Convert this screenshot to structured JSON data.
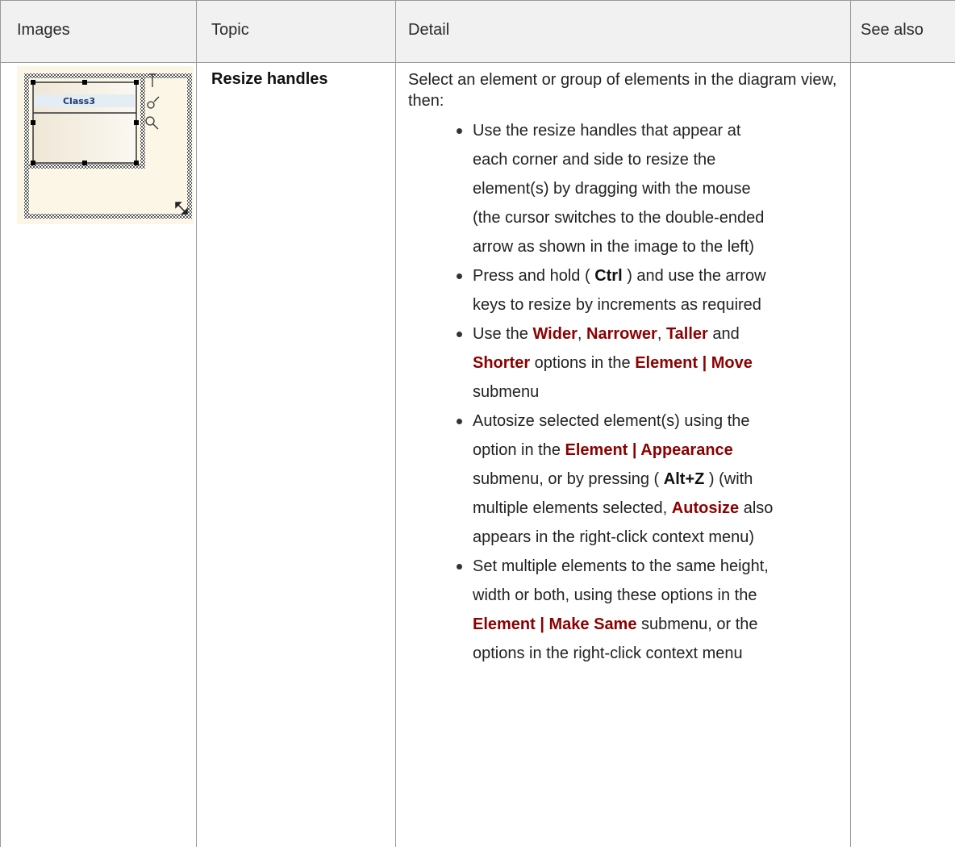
{
  "headers": {
    "images": "Images",
    "topic": "Topic",
    "detail": "Detail",
    "see_also": "See also"
  },
  "row": {
    "image": {
      "class_label": "Class3"
    },
    "topic": "Resize handles",
    "intro": "Select an element or group of elements in the diagram view, then:",
    "bullets": [
      {
        "l1": "Use the resize handles that appear at",
        "l2": "each corner and side to resize the",
        "l3": "element(s) by dragging with the mouse",
        "l4": "(the cursor switches to the double-ended",
        "l5": "arrow as shown in the image to the left)"
      },
      {
        "a": "Press and hold ( ",
        "key": "Ctrl",
        "b": " )  and use the arrow",
        "c": "keys to resize by increments as required"
      },
      {
        "a": "Use the ",
        "wider": "Wider",
        "s1": ", ",
        "narrower": "Narrower",
        "s2": ", ",
        "taller": "Taller",
        "s3": " and",
        "shorter": "Shorter",
        "b": " options in the ",
        "menu": "Element | Move",
        "c": "submenu"
      },
      {
        "a": "Autosize selected element(s) using the",
        "b": "option in the ",
        "menu": "Element | Appearance",
        "c": "submenu, or by pressing ( ",
        "key": "Alt+Z",
        "d": " ) (with",
        "e": "multiple elements selected, ",
        "autosize": "Autosize",
        "f": " also",
        "g": "appears in the right-click context menu)"
      },
      {
        "a": "Set multiple elements to the same height,",
        "b": "width or both, using these options in the",
        "menu": "Element | Make Same",
        "c": " submenu, or the",
        "d": "options in the right-click context menu"
      }
    ]
  },
  "colors": {
    "grid": "#9a9a9a",
    "header_bg": "#f1f1f1",
    "ui_reference": "#8b0000",
    "thumbnail_bg": "#fbf6e6"
  }
}
